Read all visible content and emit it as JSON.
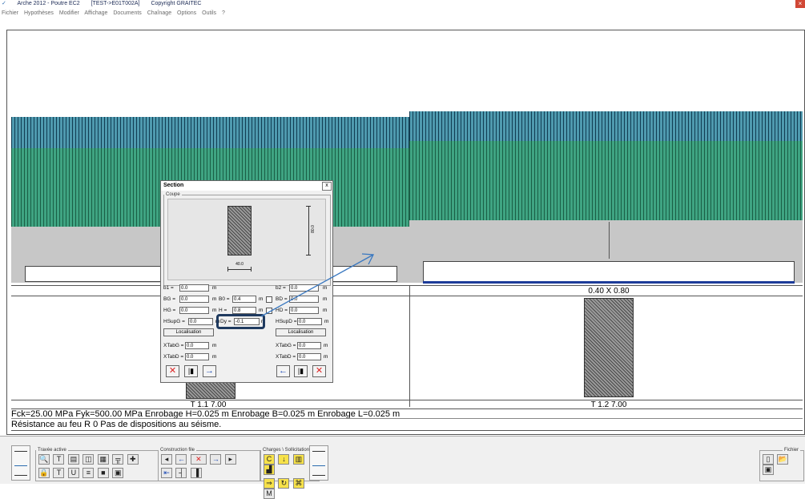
{
  "window": {
    "title_app": "Arche 2012 - Poutre EC2",
    "title_file": "[TEST->E01T002A]",
    "title_copyright": "Copyright GRAITEC"
  },
  "menu": [
    "Fichier",
    "Hypothèses",
    "Modifier",
    "Affichage",
    "Documents",
    "Chaînage",
    "Options",
    "Outils",
    "?"
  ],
  "beam": {
    "span1_label": "T 1.1  7.00",
    "span2_label": "T 1.2  7.00",
    "section2_dims": "0.40 X 0.80"
  },
  "info": {
    "line1": "Fck=25.00 MPa   Fyk=500.00 MPa   Enrobage H=0.025 m   Enrobage B=0.025 m   Enrobage L=0.025 m",
    "line2": "Résistance au feu R 0       Pas de dispositions au séisme."
  },
  "toolbar": {
    "group_travee": "Travée active",
    "group_construction": "Construction file",
    "group_charges": "Charges \\ Sollicitations",
    "group_fichier": "Fichier"
  },
  "dialog": {
    "title": "Section",
    "close_glyph": "x",
    "coupe_label": "Coupe",
    "width_dim": "40.0",
    "height_dim": "80.0",
    "fields_left": [
      {
        "label": "b1 =",
        "value": "0.0",
        "unit": "m"
      },
      {
        "label": "BG =",
        "value": "0.0",
        "unit": "m"
      },
      {
        "label": "HG =",
        "value": "0.0",
        "unit": "m"
      },
      {
        "label": "HSupG =",
        "value": "0.0",
        "unit": "m"
      }
    ],
    "fields_mid": [
      {
        "label": "B0 =",
        "value": "0.4",
        "unit": "m"
      },
      {
        "label": "H =",
        "value": "0.8",
        "unit": "m"
      },
      {
        "label": "Dy =",
        "value": "-0.1",
        "unit": "m"
      }
    ],
    "fields_right": [
      {
        "label": "b2 =",
        "value": "0.0",
        "unit": "m"
      },
      {
        "label": "BD =",
        "value": "0.0",
        "unit": "m"
      },
      {
        "label": "HD =",
        "value": "0.0",
        "unit": "m"
      },
      {
        "label": "HSupD =",
        "value": "0.0",
        "unit": "m"
      }
    ],
    "localisation": "Localisation",
    "xtab_left": [
      {
        "label": "XTabG =",
        "value": "0.0",
        "unit": "m"
      },
      {
        "label": "XTabD =",
        "value": "0.0",
        "unit": "m"
      }
    ],
    "xtab_right": [
      {
        "label": "XTabG =",
        "value": "0.0",
        "unit": "m"
      },
      {
        "label": "XTabD =",
        "value": "0.0",
        "unit": "m"
      }
    ]
  },
  "colors": {
    "highlight_box": "#1f3a5f",
    "arrow": "#3a78c0",
    "hatch_blue": "#4f9aaf",
    "hatch_green": "#3fa482"
  }
}
